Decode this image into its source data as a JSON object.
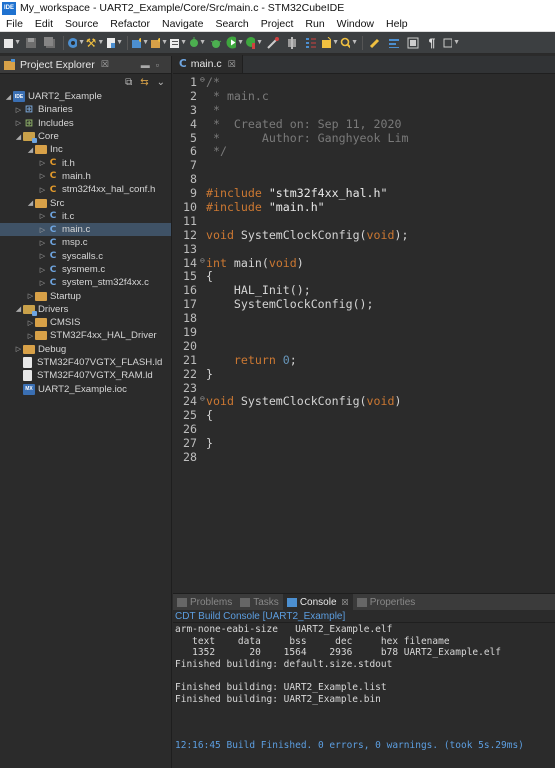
{
  "window": {
    "title": "My_workspace - UART2_Example/Core/Src/main.c - STM32CubeIDE",
    "app_icon": "IDE"
  },
  "menu": [
    "File",
    "Edit",
    "Source",
    "Refactor",
    "Navigate",
    "Search",
    "Project",
    "Run",
    "Window",
    "Help"
  ],
  "project_explorer": {
    "tab_label": "Project Explorer",
    "tab_close": "☒",
    "tree": [
      {
        "level": 0,
        "arrow": "◢",
        "icon": "project",
        "icon_text": "IDE",
        "label": "UART2_Example"
      },
      {
        "level": 1,
        "arrow": "▷",
        "icon": "binaries",
        "icon_text": "⊞",
        "label": "Binaries"
      },
      {
        "level": 1,
        "arrow": "▷",
        "icon": "includes",
        "icon_text": "⊞",
        "label": "Includes"
      },
      {
        "level": 1,
        "arrow": "◢",
        "icon": "srcfolder",
        "icon_text": "",
        "label": "Core"
      },
      {
        "level": 2,
        "arrow": "◢",
        "icon": "folder",
        "icon_text": "",
        "label": "Inc"
      },
      {
        "level": 3,
        "arrow": "▷",
        "icon": "hfile",
        "icon_text": "C",
        "label": "it.h"
      },
      {
        "level": 3,
        "arrow": "▷",
        "icon": "hfile",
        "icon_text": "C",
        "label": "main.h"
      },
      {
        "level": 3,
        "arrow": "▷",
        "icon": "hfile",
        "icon_text": "C",
        "label": "stm32f4xx_hal_conf.h"
      },
      {
        "level": 2,
        "arrow": "◢",
        "icon": "folder",
        "icon_text": "",
        "label": "Src"
      },
      {
        "level": 3,
        "arrow": "▷",
        "icon": "cfile",
        "icon_text": "C",
        "label": "it.c"
      },
      {
        "level": 3,
        "arrow": "▷",
        "icon": "cfile",
        "icon_text": "C",
        "label": "main.c",
        "selected": true
      },
      {
        "level": 3,
        "arrow": "▷",
        "icon": "cfile",
        "icon_text": "C",
        "label": "msp.c"
      },
      {
        "level": 3,
        "arrow": "▷",
        "icon": "cfile",
        "icon_text": "C",
        "label": "syscalls.c"
      },
      {
        "level": 3,
        "arrow": "▷",
        "icon": "cfile",
        "icon_text": "C",
        "label": "sysmem.c"
      },
      {
        "level": 3,
        "arrow": "▷",
        "icon": "cfile",
        "icon_text": "C",
        "label": "system_stm32f4xx.c"
      },
      {
        "level": 2,
        "arrow": "▷",
        "icon": "folder",
        "icon_text": "",
        "label": "Startup"
      },
      {
        "level": 1,
        "arrow": "◢",
        "icon": "srcfolder",
        "icon_text": "",
        "label": "Drivers"
      },
      {
        "level": 2,
        "arrow": "▷",
        "icon": "folder",
        "icon_text": "",
        "label": "CMSIS"
      },
      {
        "level": 2,
        "arrow": "▷",
        "icon": "folder",
        "icon_text": "",
        "label": "STM32F4xx_HAL_Driver"
      },
      {
        "level": 1,
        "arrow": "▷",
        "icon": "folder",
        "icon_text": "",
        "label": "Debug"
      },
      {
        "level": 1,
        "arrow": "",
        "icon": "ldfile",
        "icon_text": "",
        "label": "STM32F407VGTX_FLASH.ld"
      },
      {
        "level": 1,
        "arrow": "",
        "icon": "ldfile",
        "icon_text": "",
        "label": "STM32F407VGTX_RAM.ld"
      },
      {
        "level": 1,
        "arrow": "",
        "icon": "ioc",
        "icon_text": "MX",
        "label": "UART2_Example.ioc"
      }
    ]
  },
  "editor": {
    "tab_label": "main.c",
    "tab_close": "☒",
    "lines": [
      {
        "n": "1",
        "fold": "⊖",
        "parts": [
          {
            "c": "cm",
            "t": "/*"
          }
        ]
      },
      {
        "n": "2",
        "parts": [
          {
            "c": "cm",
            "t": " * main.c"
          }
        ]
      },
      {
        "n": "3",
        "parts": [
          {
            "c": "cm",
            "t": " *"
          }
        ]
      },
      {
        "n": "4",
        "parts": [
          {
            "c": "cm",
            "t": " *  Created on: Sep 11, 2020"
          }
        ]
      },
      {
        "n": "5",
        "parts": [
          {
            "c": "cm",
            "t": " *      Author: Ganghyeok Lim"
          }
        ]
      },
      {
        "n": "6",
        "parts": [
          {
            "c": "cm",
            "t": " */"
          }
        ]
      },
      {
        "n": "7",
        "parts": []
      },
      {
        "n": "8",
        "parts": []
      },
      {
        "n": "9",
        "parts": [
          {
            "c": "pp",
            "t": "#include"
          },
          {
            "c": "str",
            "t": " \"stm32f4xx_hal.h\""
          }
        ]
      },
      {
        "n": "10",
        "parts": [
          {
            "c": "pp",
            "t": "#include"
          },
          {
            "c": "str",
            "t": " \"main.h\""
          }
        ]
      },
      {
        "n": "11",
        "parts": []
      },
      {
        "n": "12",
        "parts": [
          {
            "c": "kw",
            "t": "void"
          },
          {
            "c": "ident",
            "t": " SystemClockConfig("
          },
          {
            "c": "kw",
            "t": "void"
          },
          {
            "c": "ident",
            "t": ");"
          }
        ]
      },
      {
        "n": "13",
        "parts": []
      },
      {
        "n": "14",
        "fold": "⊖",
        "parts": [
          {
            "c": "kw",
            "t": "int"
          },
          {
            "c": "ident",
            "t": " main("
          },
          {
            "c": "kw",
            "t": "void"
          },
          {
            "c": "ident",
            "t": ")"
          }
        ]
      },
      {
        "n": "15",
        "parts": [
          {
            "c": "ident",
            "t": "{"
          }
        ]
      },
      {
        "n": "16",
        "parts": [
          {
            "c": "ident",
            "t": "    HAL_Init();"
          }
        ]
      },
      {
        "n": "17",
        "parts": [
          {
            "c": "ident",
            "t": "    SystemClockConfig();"
          }
        ]
      },
      {
        "n": "18",
        "parts": []
      },
      {
        "n": "19",
        "parts": []
      },
      {
        "n": "20",
        "parts": []
      },
      {
        "n": "21",
        "parts": [
          {
            "c": "ident",
            "t": "    "
          },
          {
            "c": "kw",
            "t": "return"
          },
          {
            "c": "ident",
            "t": " "
          },
          {
            "c": "num",
            "t": "0"
          },
          {
            "c": "ident",
            "t": ";"
          }
        ]
      },
      {
        "n": "22",
        "parts": [
          {
            "c": "ident",
            "t": "}"
          }
        ]
      },
      {
        "n": "23",
        "parts": []
      },
      {
        "n": "24",
        "fold": "⊖",
        "parts": [
          {
            "c": "kw",
            "t": "void"
          },
          {
            "c": "ident",
            "t": " SystemClockConfig("
          },
          {
            "c": "kw",
            "t": "void"
          },
          {
            "c": "ident",
            "t": ")"
          }
        ]
      },
      {
        "n": "25",
        "parts": [
          {
            "c": "ident",
            "t": "{"
          }
        ]
      },
      {
        "n": "26",
        "parts": []
      },
      {
        "n": "27",
        "parts": [
          {
            "c": "ident",
            "t": "}"
          }
        ]
      },
      {
        "n": "28",
        "parts": []
      }
    ]
  },
  "bottom_panel": {
    "tabs": [
      {
        "label": "Problems",
        "active": false
      },
      {
        "label": "Tasks",
        "active": false
      },
      {
        "label": "Console",
        "active": true
      },
      {
        "label": "Properties",
        "active": false
      }
    ],
    "console_title": "CDT Build Console [UART2_Example]",
    "console_lines": [
      {
        "t": "arm-none-eabi-size   UART2_Example.elf",
        "blue": false
      },
      {
        "t": "   text    data     bss     dec     hex filename",
        "blue": false
      },
      {
        "t": "   1352      20    1564    2936     b78 UART2_Example.elf",
        "blue": false
      },
      {
        "t": "Finished building: default.size.stdout",
        "blue": false
      },
      {
        "t": " ",
        "blue": false
      },
      {
        "t": "Finished building: UART2_Example.list",
        "blue": false
      },
      {
        "t": "Finished building: UART2_Example.bin",
        "blue": false
      },
      {
        "t": " ",
        "blue": false
      },
      {
        "t": " ",
        "blue": false
      },
      {
        "t": " ",
        "blue": false
      },
      {
        "t": "12:16:45 Build Finished. 0 errors, 0 warnings. (took 5s.29ms)",
        "blue": true
      }
    ]
  },
  "toolbar_icons": [
    "new-icon",
    "save-icon",
    "save-all-icon",
    "settings-icon",
    "build-icon",
    "new-file-icon",
    "new-class-icon",
    "new-project-icon",
    "open-type-icon",
    "debug-icon",
    "bug-icon",
    "run-icon",
    "run-config-icon",
    "external-tools-icon",
    "pin-icon",
    "search-icon",
    "highlight-icon",
    "show-whitespace-icon",
    "pilcrow-icon",
    "back-icon"
  ],
  "colors": {
    "accent": "#4c8fd0",
    "keyword": "#cc7832",
    "comment": "#7a7a7a",
    "number": "#6897bb",
    "console_link": "#5c9ee0",
    "selection": "#3f5266"
  }
}
